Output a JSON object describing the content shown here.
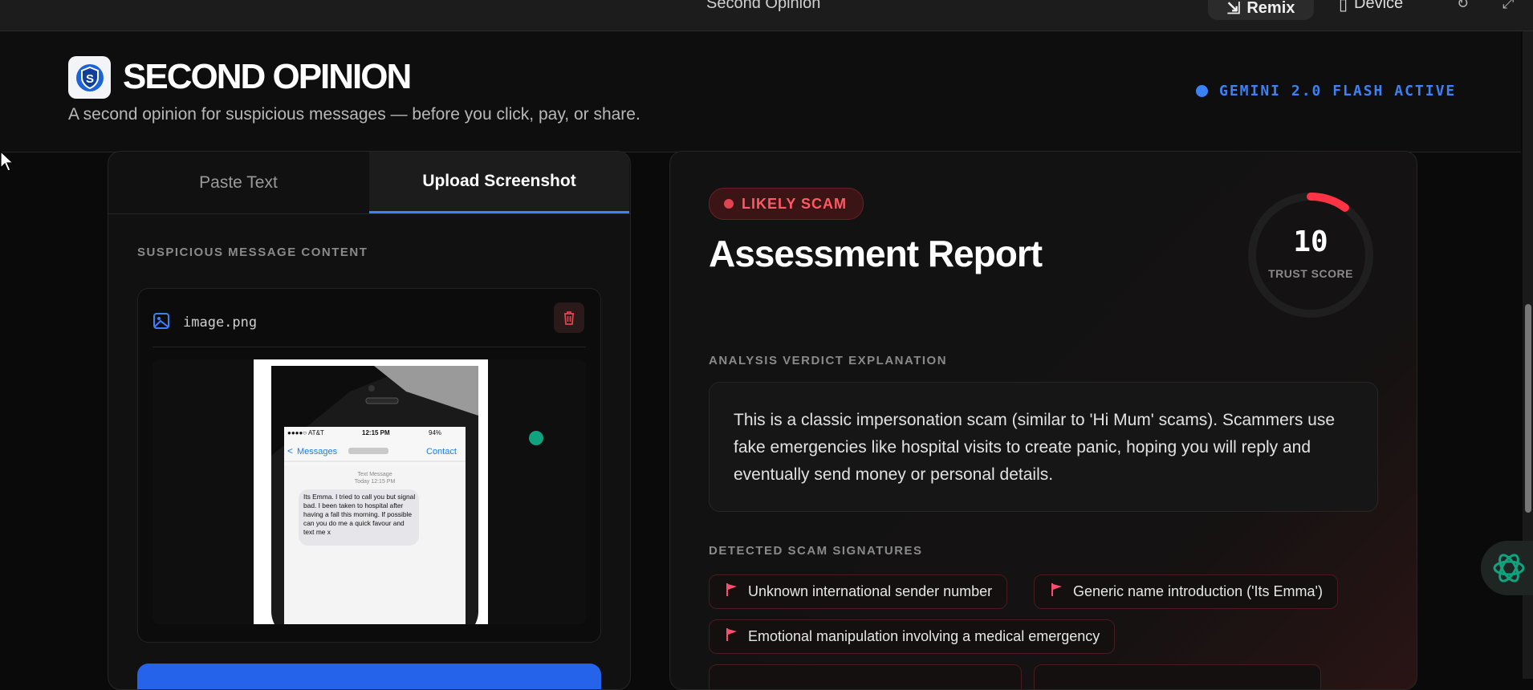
{
  "topbar": {
    "title": "Second Opinion",
    "remix_label": "Remix",
    "device_label": "Device"
  },
  "header": {
    "brand": "SECOND OPINION",
    "tagline": "A second opinion for suspicious messages — before you click, pay, or share.",
    "model_status": "GEMINI 2.0 FLASH ACTIVE"
  },
  "input_panel": {
    "tabs": [
      {
        "label": "Paste Text",
        "active": false
      },
      {
        "label": "Upload Screenshot",
        "active": true
      }
    ],
    "section_label": "SUSPICIOUS MESSAGE CONTENT",
    "file_name": "image.png",
    "preview": {
      "status_left": "●●●●○ AT&T",
      "status_time": "12:15 PM",
      "status_right": "94%",
      "back_label": "Messages",
      "contact_label": "Contact",
      "message_meta": "Text Message",
      "message_time": "Today 12:15 PM",
      "message_text": "Its Emma. I tried to call you but signal bad. I been taken to hospital after having a fall this morning. If possible can you do me a quick favour and text me x"
    }
  },
  "report": {
    "verdict": "LIKELY SCAM",
    "title": "Assessment Report",
    "trust_score": "10",
    "trust_score_max": 100,
    "trust_score_label": "TRUST SCORE",
    "explanation_label": "ANALYSIS VERDICT EXPLANATION",
    "explanation": "This is a classic impersonation scam (similar to 'Hi Mum' scams). Scammers use fake emergencies like hospital visits to create panic, hoping you will reply and eventually send money or personal details.",
    "signatures_label": "DETECTED SCAM SIGNATURES",
    "signatures": [
      "Unknown international sender number",
      "Generic name introduction ('Its Emma')",
      "Emotional manipulation involving a medical emergency"
    ]
  },
  "colors": {
    "accent_blue": "#3b82f6",
    "danger": "#ff4757",
    "assistant_green": "#10a37f"
  }
}
